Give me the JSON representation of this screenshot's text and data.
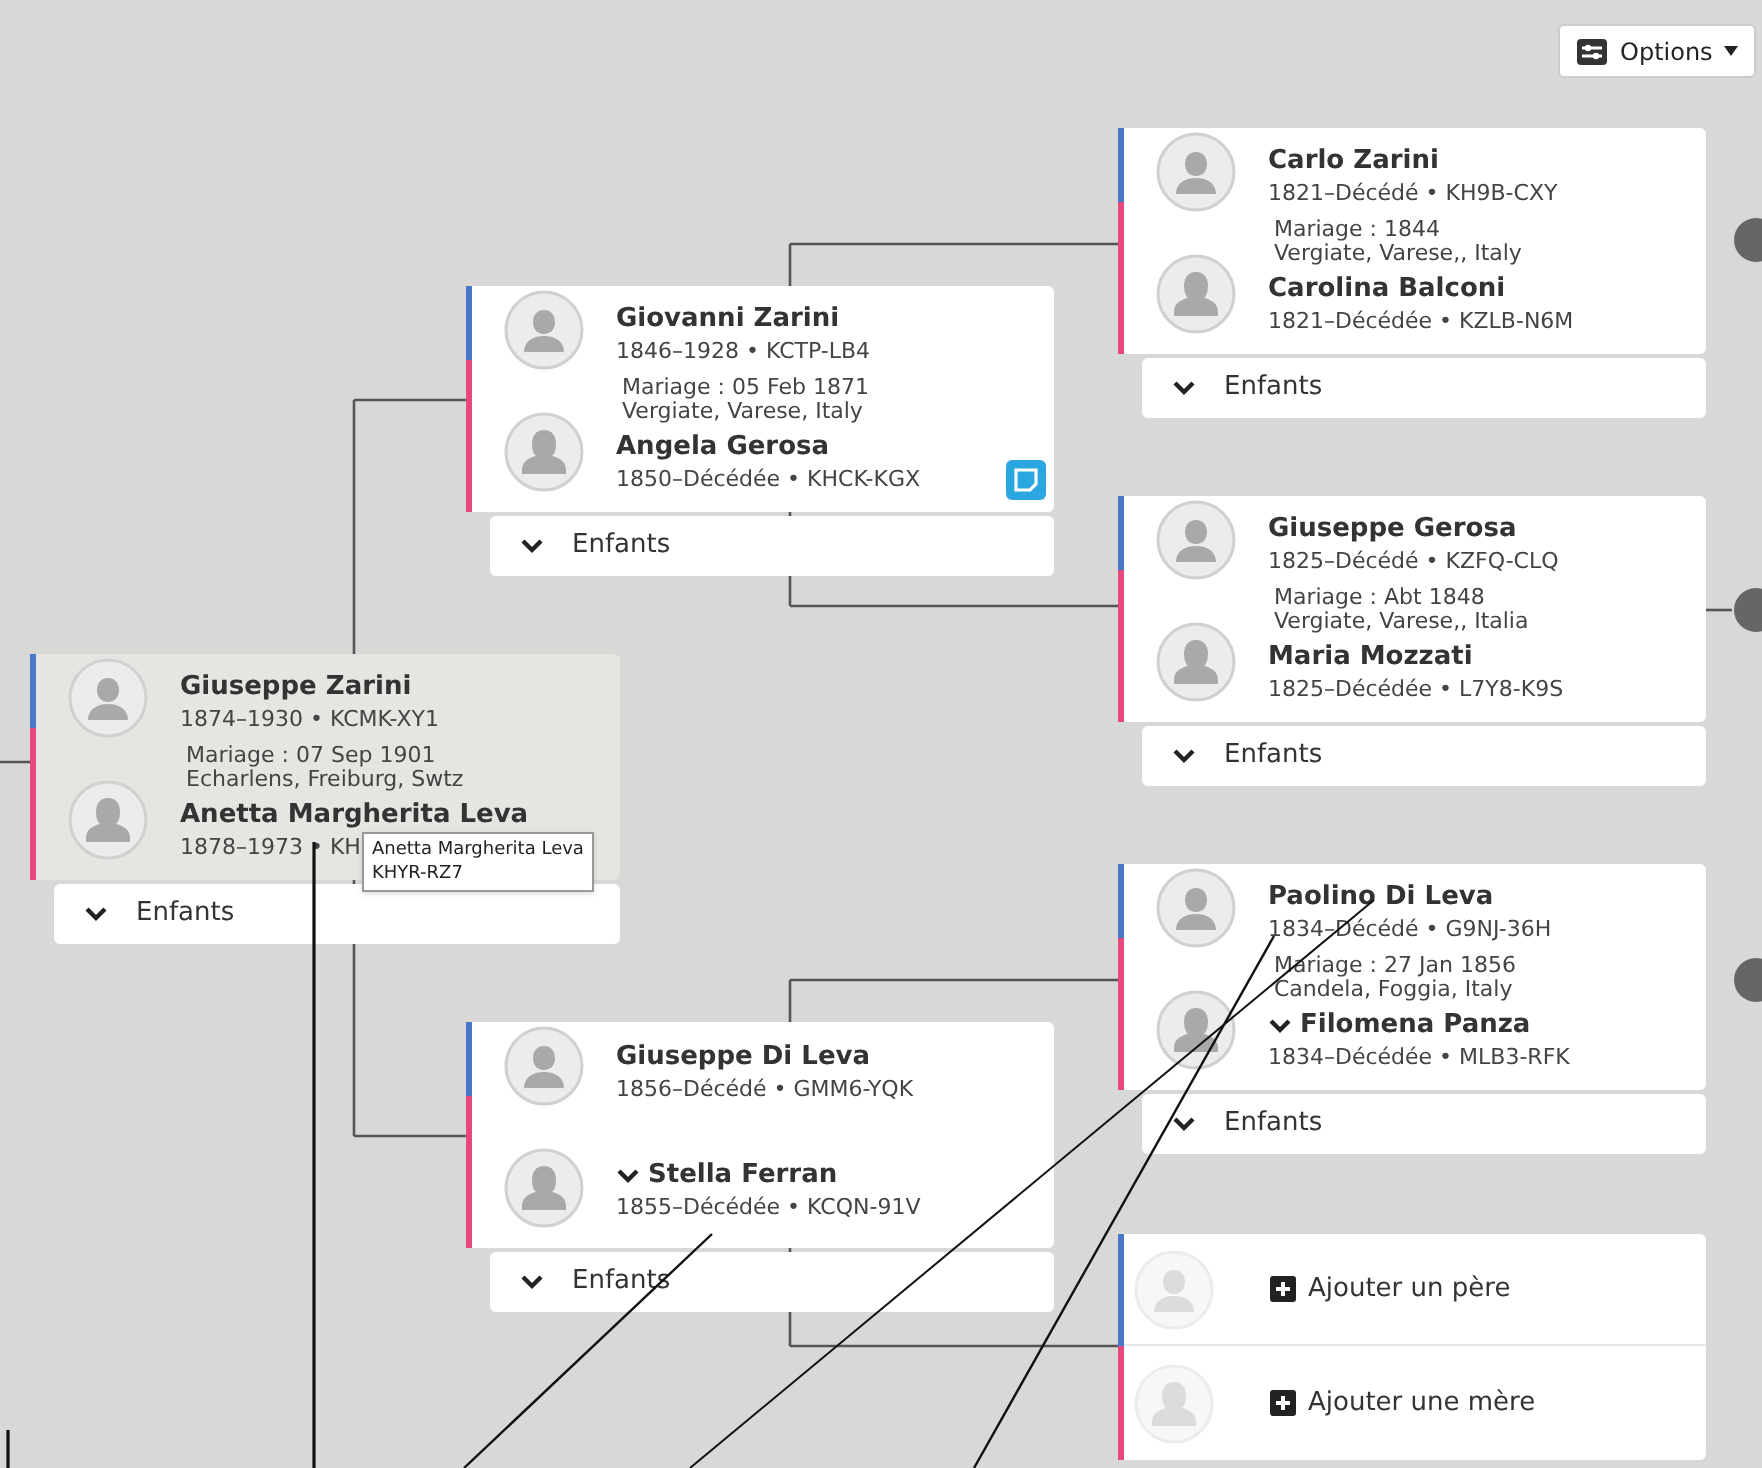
{
  "options_button": {
    "label": "Options"
  },
  "couples": [
    {
      "highlighted": true,
      "husband": {
        "name": "Giuseppe Zarini",
        "details": "1874–1930 • KCMK-XY1",
        "caret": false,
        "note": false
      },
      "marriage": [
        "Mariage : 07 Sep 1901",
        "Echarlens, Freiburg, Swtz"
      ],
      "wife": {
        "name": "Anetta Margherita Leva",
        "details": "1878–1973 • KH",
        "caret": false,
        "note": false
      },
      "children_toggle": "Enfants"
    },
    {
      "highlighted": false,
      "husband": {
        "name": "Giovanni Zarini",
        "details": "1846–1928 • KCTP-LB4",
        "caret": false,
        "note": false
      },
      "marriage": [
        "Mariage : 05 Feb 1871",
        "Vergiate, Varese, Italy"
      ],
      "wife": {
        "name": "Angela Gerosa",
        "details": "1850–Décédée • KHCK-KGX",
        "caret": false,
        "note": true
      },
      "children_toggle": "Enfants"
    },
    {
      "highlighted": false,
      "husband": {
        "name": "Giuseppe Di Leva",
        "details": "1856–Décédé • GMM6-YQK",
        "caret": false,
        "note": false
      },
      "wife": {
        "name": "Stella Ferran",
        "details": "1855–Décédée • KCQN-91V",
        "caret": true,
        "note": false
      },
      "children_toggle": "Enfants"
    },
    {
      "highlighted": false,
      "husband": {
        "name": "Carlo Zarini",
        "details": "1821–Décédé • KH9B-CXY",
        "caret": false,
        "note": false
      },
      "marriage": [
        "Mariage : 1844",
        "Vergiate, Varese,, Italy"
      ],
      "wife": {
        "name": "Carolina Balconi",
        "details": "1821–Décédée • KZLB-N6M",
        "caret": false,
        "note": false
      },
      "children_toggle": "Enfants"
    },
    {
      "highlighted": false,
      "husband": {
        "name": "Giuseppe Gerosa",
        "details": "1825–Décédé • KZFQ-CLQ",
        "caret": false,
        "note": false
      },
      "marriage": [
        "Mariage : Abt 1848",
        "Vergiate, Varese,, Italia"
      ],
      "wife": {
        "name": "Maria Mozzati",
        "details": "1825–Décédée • L7Y8-K9S",
        "caret": false,
        "note": false
      },
      "children_toggle": "Enfants"
    },
    {
      "highlighted": false,
      "husband": {
        "name": "Paolino Di Leva",
        "details": "1834–Décédé • G9NJ-36H",
        "caret": false,
        "note": false
      },
      "marriage": [
        "Mariage : 27 Jan 1856",
        "Candela, Foggia, Italy"
      ],
      "wife": {
        "name": "Filomena Panza",
        "details": "1834–Décédée • MLB3-RFK",
        "caret": true,
        "note": false
      },
      "children_toggle": "Enfants"
    }
  ],
  "add_parents": {
    "father": "Ajouter un père",
    "mother": "Ajouter une mère"
  },
  "tooltip": {
    "lines": [
      "Anetta Margherita Leva",
      "KHYR-RZ7"
    ]
  }
}
